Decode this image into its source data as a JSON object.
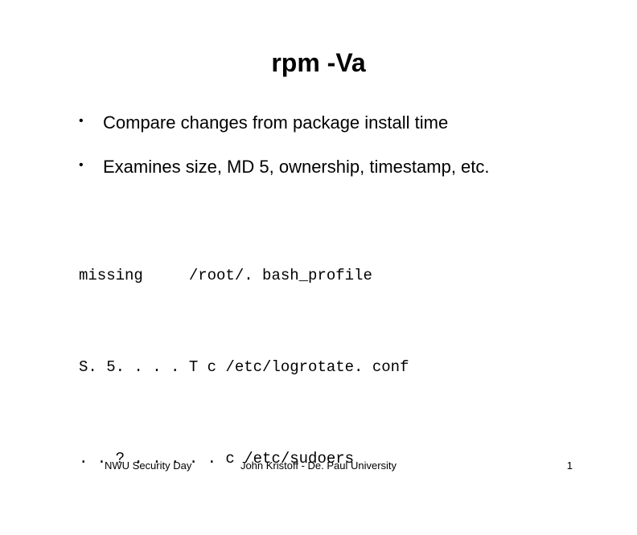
{
  "title": "rpm -Va",
  "bullets": [
    "Compare changes from package install time",
    "Examines size, MD 5, ownership, timestamp, etc."
  ],
  "code_lines": [
    "missing     /root/. bash_profile",
    "S. 5. . . . T c /etc/logrotate. conf",
    ". . ? . . . . . c /etc/sudoers"
  ],
  "footer": {
    "left": "NWU Security Day",
    "center": "John Kristoff - De. Paul University",
    "right": "1"
  }
}
